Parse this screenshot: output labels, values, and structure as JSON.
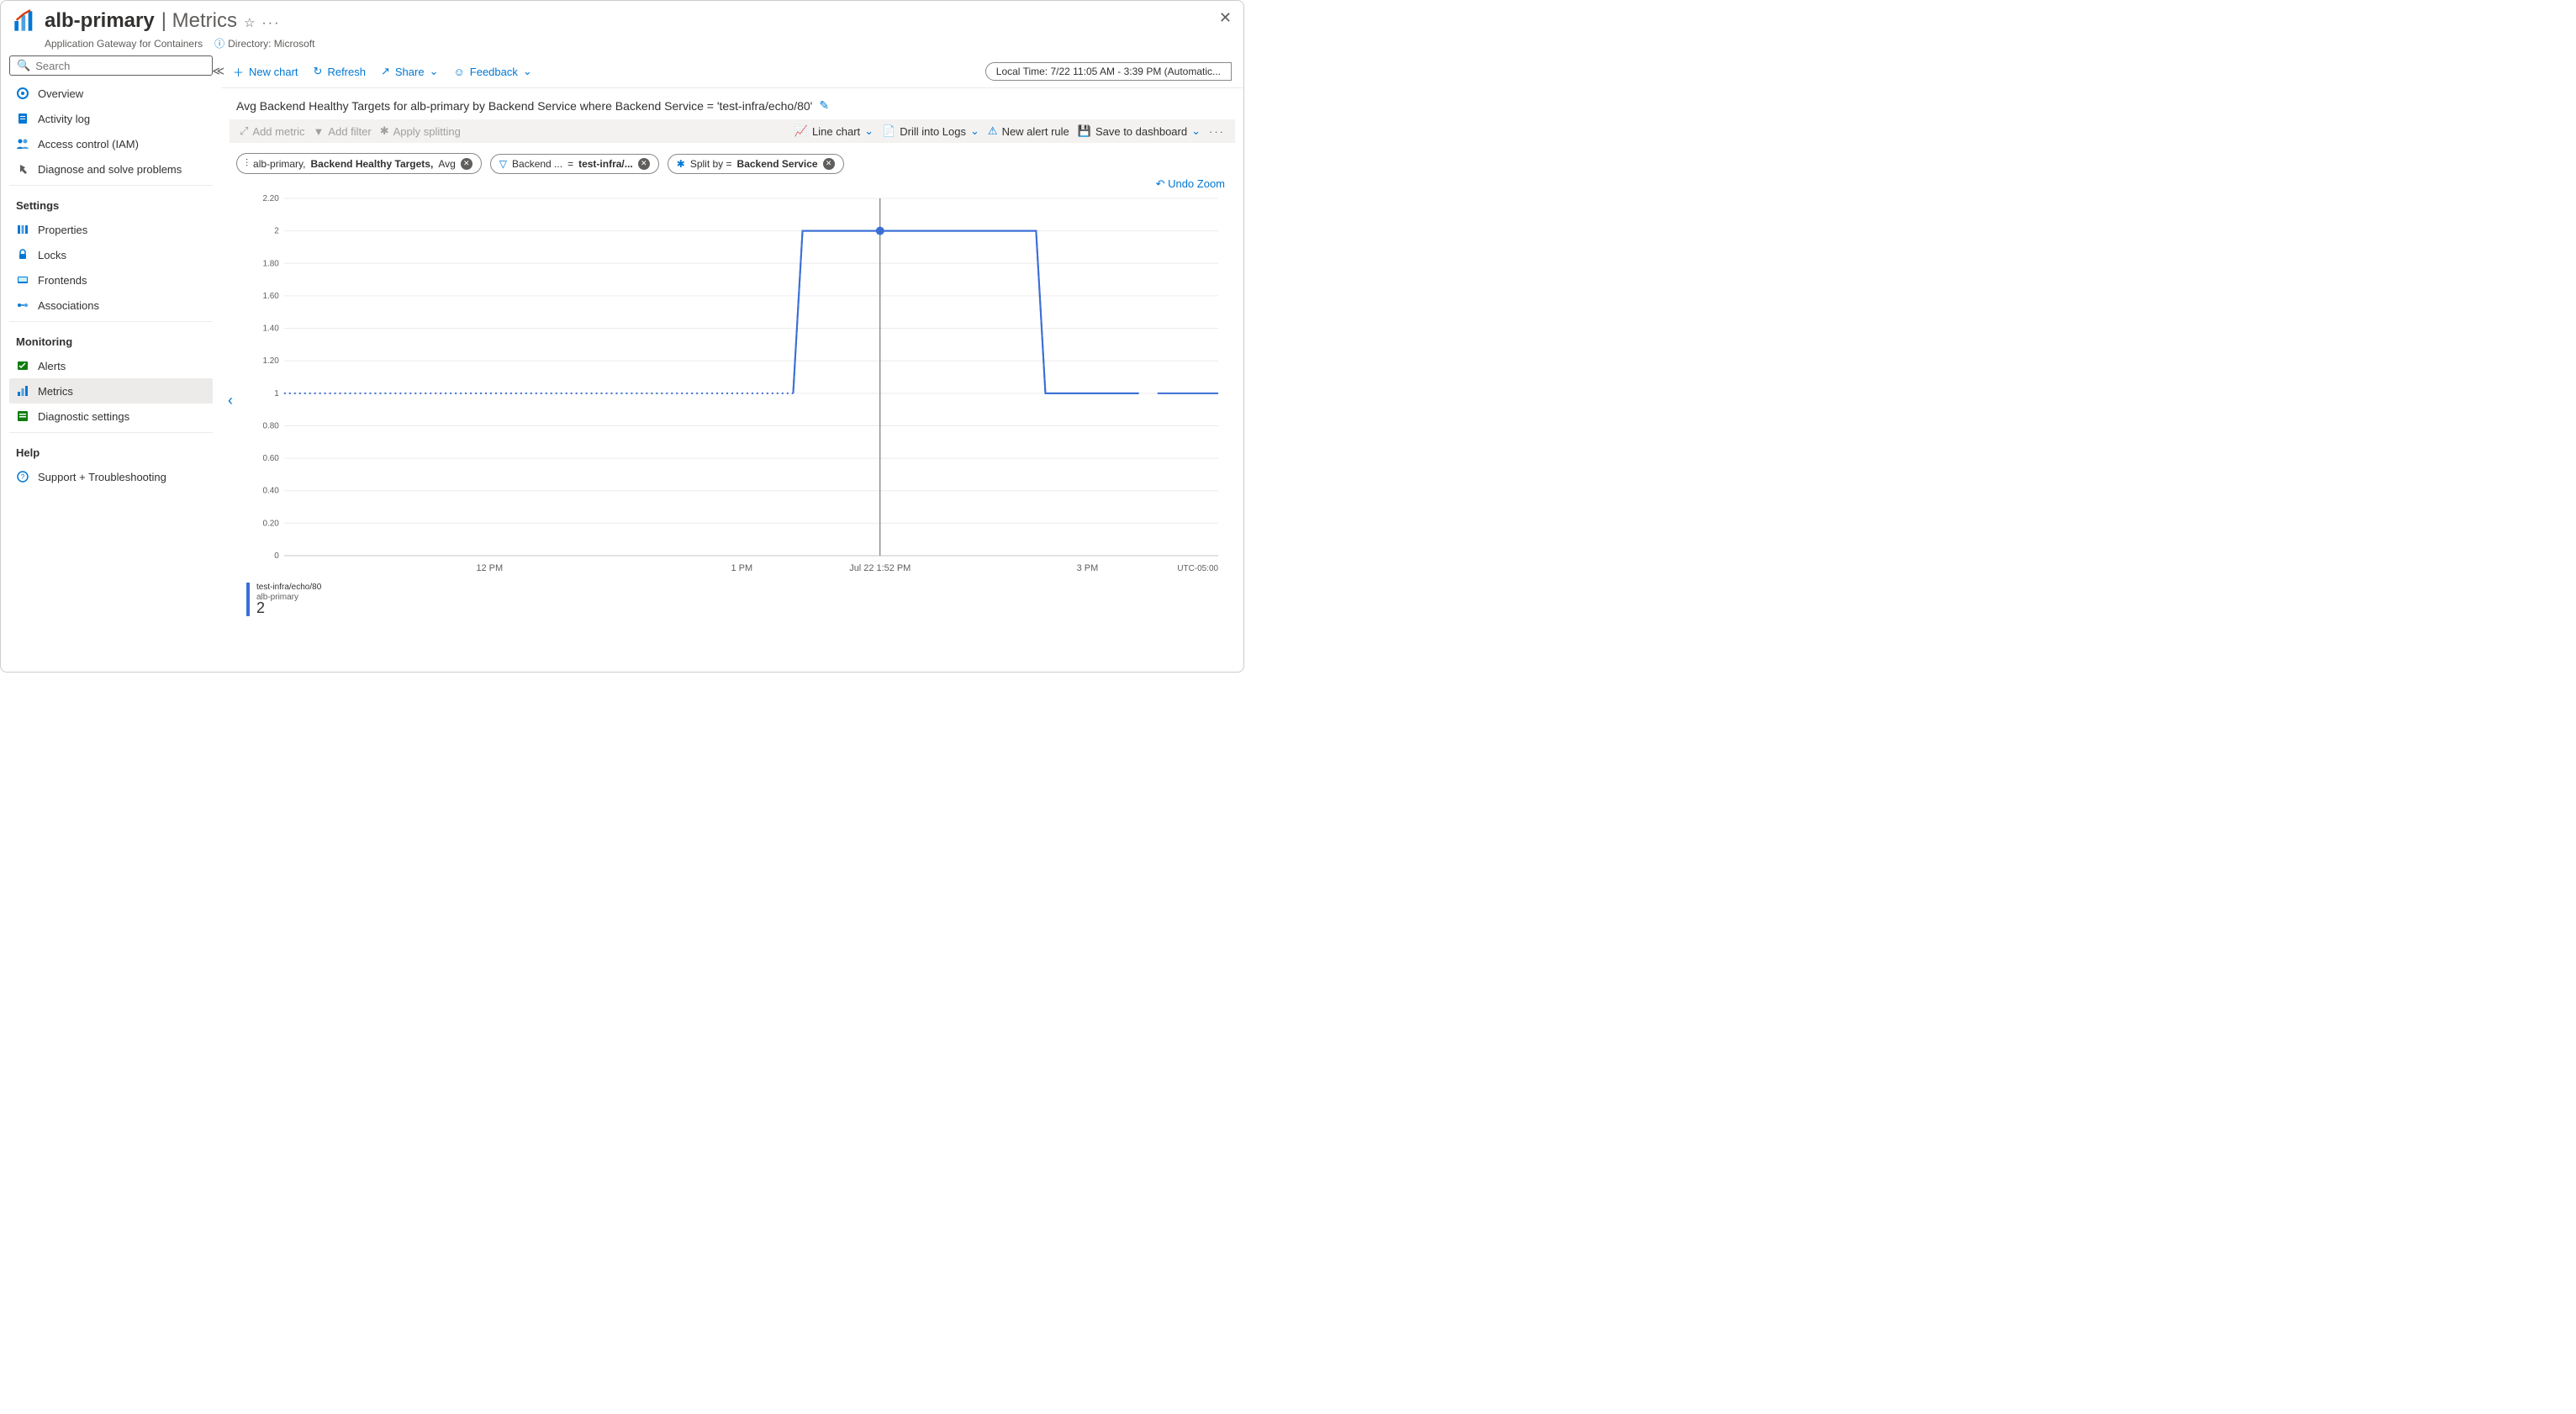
{
  "header": {
    "resource": "alb-primary",
    "page": "Metrics",
    "subtitle": "Application Gateway for Containers",
    "dir_label": "Directory: Microsoft"
  },
  "search": {
    "placeholder": "Search"
  },
  "nav": {
    "top": [
      {
        "label": "Overview",
        "key": "overview"
      },
      {
        "label": "Activity log",
        "key": "activity"
      },
      {
        "label": "Access control (IAM)",
        "key": "iam"
      },
      {
        "label": "Diagnose and solve problems",
        "key": "diag"
      }
    ],
    "settings_h": "Settings",
    "settings": [
      {
        "label": "Properties",
        "key": "props"
      },
      {
        "label": "Locks",
        "key": "locks"
      },
      {
        "label": "Frontends",
        "key": "frontends"
      },
      {
        "label": "Associations",
        "key": "assoc"
      }
    ],
    "monitoring_h": "Monitoring",
    "monitoring": [
      {
        "label": "Alerts",
        "key": "alerts"
      },
      {
        "label": "Metrics",
        "key": "metrics",
        "sel": true
      },
      {
        "label": "Diagnostic settings",
        "key": "diagset"
      }
    ],
    "help_h": "Help",
    "help": [
      {
        "label": "Support + Troubleshooting",
        "key": "support"
      }
    ]
  },
  "toolbar": {
    "new_chart": "New chart",
    "refresh": "Refresh",
    "share": "Share",
    "feedback": "Feedback",
    "time": "Local Time: 7/22 11:05 AM - 3:39 PM (Automatic..."
  },
  "chart": {
    "title": "Avg Backend Healthy Targets for alb-primary by Backend Service where Backend Service = 'test-infra/echo/80'"
  },
  "chartbar": {
    "add_metric": "Add metric",
    "add_filter": "Add filter",
    "apply_split": "Apply splitting",
    "line_chart": "Line chart",
    "drill": "Drill into Logs",
    "alert": "New alert rule",
    "save": "Save to dashboard"
  },
  "pills": {
    "metric_res": "alb-primary,",
    "metric_name": "Backend Healthy Targets,",
    "metric_agg": "Avg",
    "filter_dim": "Backend ...",
    "filter_eq": "=",
    "filter_val": "test-infra/...",
    "split_label": "Split by =",
    "split_val": "Backend Service"
  },
  "undo": "Undo Zoom",
  "chart_data": {
    "type": "line",
    "ylim": [
      0,
      2.2
    ],
    "yticks": [
      "0",
      "0.20",
      "0.40",
      "0.60",
      "0.80",
      "1",
      "1.20",
      "1.40",
      "1.60",
      "1.80",
      "2",
      "2.20"
    ],
    "xticks": [
      "12 PM",
      "1 PM",
      "Jul 22 1:52 PM",
      "3 PM"
    ],
    "xtick_pos": [
      0.22,
      0.49,
      0.638,
      0.86
    ],
    "marker_x": 0.638,
    "marker_y": 2,
    "utc": "UTC-05:00",
    "series": [
      {
        "name": "test-infra/echo/80",
        "resource": "alb-primary",
        "current": "2",
        "points": [
          {
            "x": 0.0,
            "y": 1,
            "dash": true
          },
          {
            "x": 0.545,
            "y": 1,
            "dash": true
          },
          {
            "x": 0.545,
            "y": 1
          },
          {
            "x": 0.555,
            "y": 2
          },
          {
            "x": 0.805,
            "y": 2
          },
          {
            "x": 0.815,
            "y": 1
          },
          {
            "x": 0.915,
            "y": 1
          },
          {
            "x": 0.925,
            "y": 1,
            "gap": true
          },
          {
            "x": 0.935,
            "y": 1
          },
          {
            "x": 1.0,
            "y": 1
          }
        ]
      }
    ]
  }
}
